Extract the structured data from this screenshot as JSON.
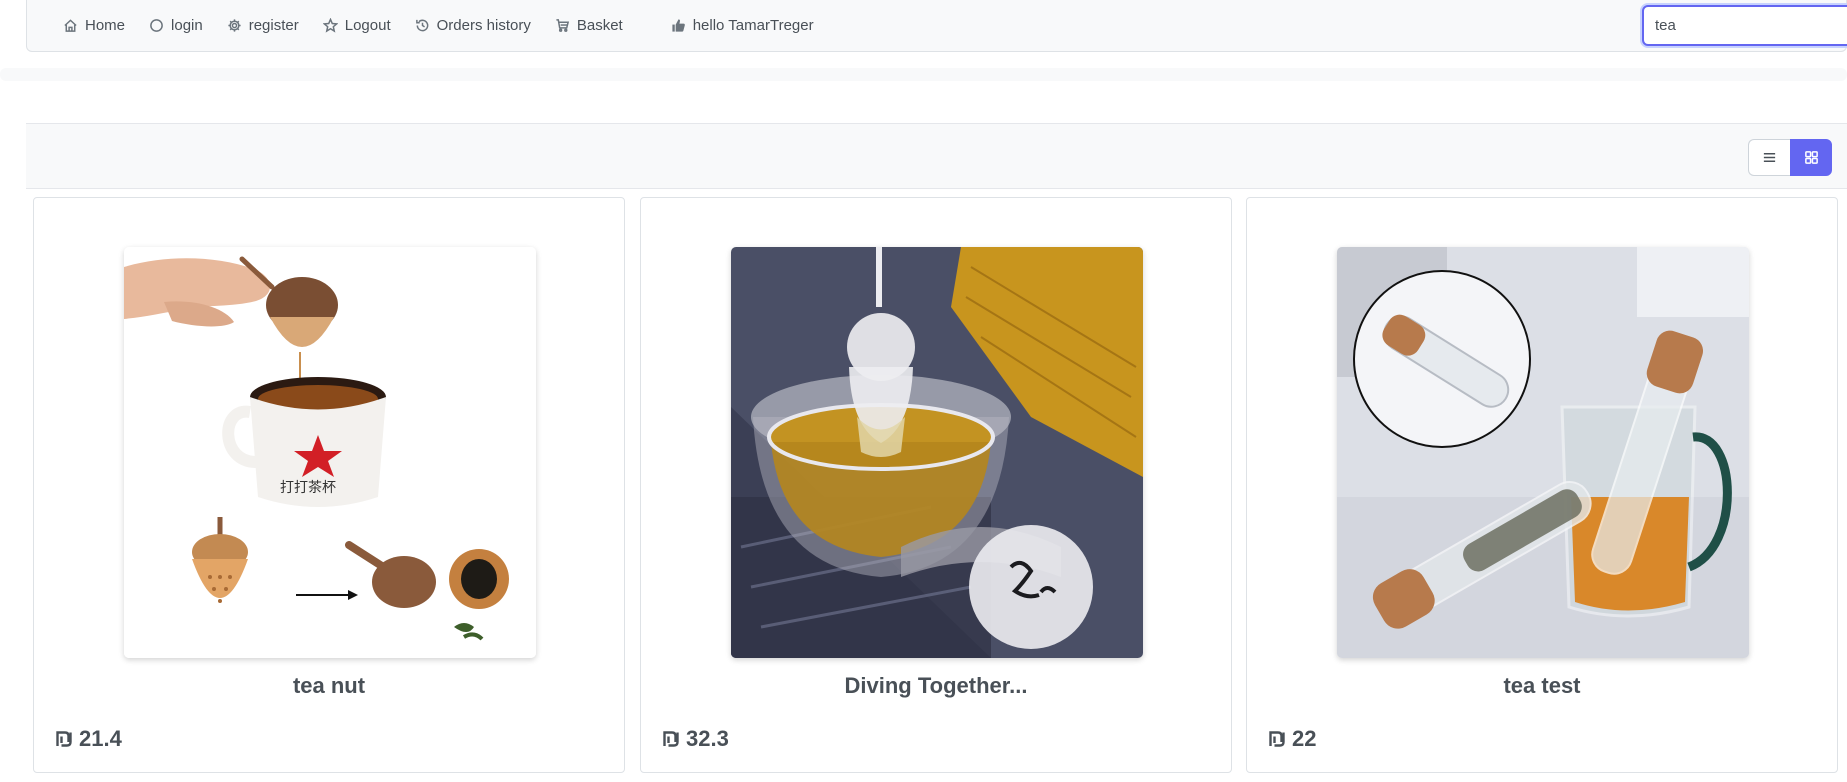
{
  "menu": {
    "items": [
      {
        "label": "Home",
        "icon": "home-icon"
      },
      {
        "label": "login",
        "icon": "circle-icon"
      },
      {
        "label": "register",
        "icon": "cog-icon"
      },
      {
        "label": "Logout",
        "icon": "star-icon"
      },
      {
        "label": "Orders history",
        "icon": "history-icon"
      },
      {
        "label": "Basket",
        "icon": "cart-icon"
      },
      {
        "label": "hello TamarTreger",
        "icon": "thumbs-up-icon"
      }
    ],
    "search": {
      "value": "tea"
    }
  },
  "layout_options": {
    "list": "list-icon",
    "grid": "grid-icon",
    "active": "grid"
  },
  "products": [
    {
      "name": "tea nut",
      "price": "21.4",
      "image": "acorn-tea-infuser-with-mug"
    },
    {
      "name": "Diving Together...",
      "price": "32.3",
      "image": "silicone-diver-infuser-in-glass-cup"
    },
    {
      "name": "tea test",
      "price": "22",
      "image": "glass-tube-infuser-with-cork"
    }
  ],
  "currency_icon": "shekel-icon",
  "colors": {
    "accent": "#6366f1",
    "menubar_bg": "#f8f9fa",
    "text": "#495057"
  }
}
